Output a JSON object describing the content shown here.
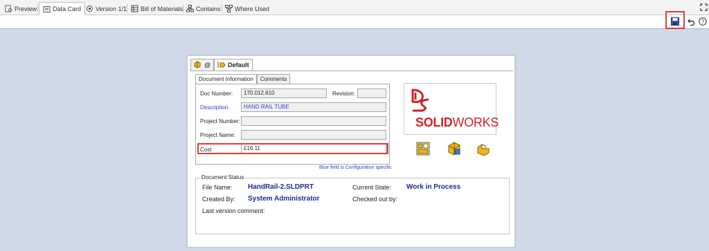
{
  "tabs": [
    {
      "label": "Preview",
      "icon": "preview-icon",
      "active": false
    },
    {
      "label": "Data Card",
      "icon": "data-card-icon",
      "active": true
    },
    {
      "label": "Version 1/1",
      "icon": "version-icon",
      "active": false
    },
    {
      "label": "Bill of Materials",
      "icon": "bill-of-materials-icon",
      "active": false
    },
    {
      "label": "Contains",
      "icon": "contains-icon",
      "active": false
    },
    {
      "label": "Where Used",
      "icon": "where-used-icon",
      "active": false
    }
  ],
  "toolbar": {
    "save_icon": "save-icon",
    "undo_icon": "undo-icon",
    "help_icon": "help-icon",
    "expand_icon": "expand-icon"
  },
  "card": {
    "config_tabs": [
      {
        "label": "@",
        "icon": "part-config-icon",
        "active": false
      },
      {
        "label": "Default",
        "icon": "configuration-icon",
        "active": true
      }
    ],
    "sub_tabs": [
      {
        "label": "Document Information",
        "active": true
      },
      {
        "label": "Comments",
        "active": false
      }
    ],
    "fields": {
      "doc_number": {
        "label": "Doc Number:",
        "value": "170.012.610"
      },
      "revision": {
        "label": "Revision:",
        "value": ""
      },
      "description": {
        "label": "Description:",
        "value": "HAND RAIL TUBE"
      },
      "project_number": {
        "label": "Project Number:",
        "value": ""
      },
      "project_name": {
        "label": "Project Name:",
        "value": ""
      },
      "cost": {
        "label": "Cost",
        "value": "£16.11"
      }
    },
    "logo": {
      "word_bold": "SOLID",
      "word_light": "WORKS"
    },
    "note": "Blue field is Configuration specific",
    "status": {
      "title": "Document Status",
      "file_name_label": "File Name:",
      "file_name": "HandRail-2.SLDPRT",
      "created_by_label": "Created By:",
      "created_by": "System Administrator",
      "current_state_label": "Current State:",
      "current_state": "Work in Process",
      "checked_out_by_label": "Checked out by:",
      "checked_out_by": "",
      "last_version_comment_label": "Last version comment:"
    },
    "action_icons": [
      "card-layout-icon",
      "part-icon",
      "config-part-icon"
    ]
  },
  "colors": {
    "background": "#cfd9e8",
    "highlight": "#e03a3a",
    "config_specific_text": "#2b3fd6",
    "status_value": "#1c2b8f",
    "brand_red": "#d12027"
  }
}
